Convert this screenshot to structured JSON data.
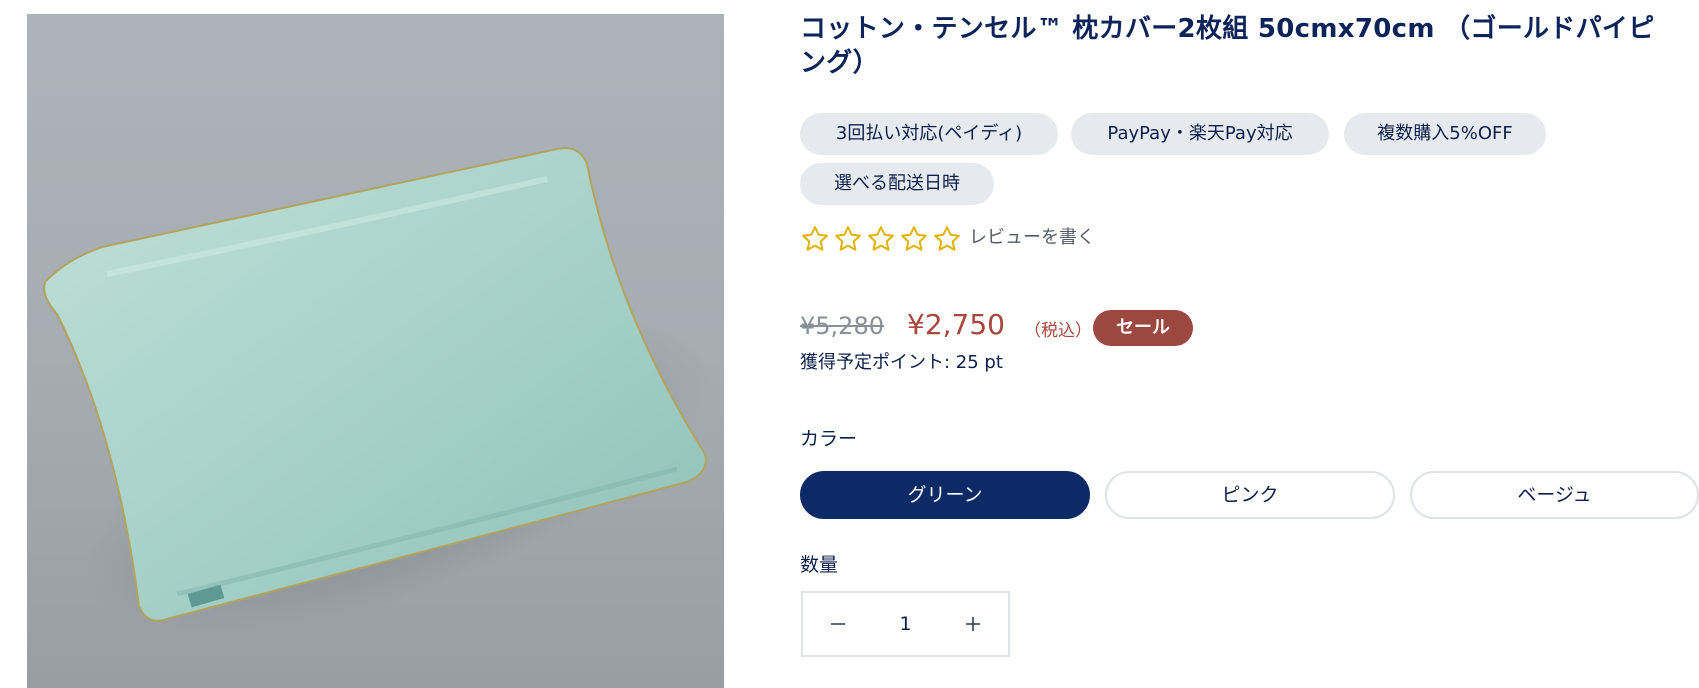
{
  "product": {
    "title": "コットン・テンセル™ 枕カバー2枚組 50cmx70cm （ゴールドパイピング）",
    "tags": [
      "3回払い対応(ペイディ)",
      "PayPay・楽天Pay対応",
      "複数購入5%OFF",
      "選べる配送日時"
    ],
    "rating": {
      "stars_filled": 0,
      "stars_total": 5,
      "review_link": "レビューを書く"
    },
    "price": {
      "original": "¥5,280",
      "sale": "¥2,750",
      "tax_note": "（税込）",
      "badge": "セール"
    },
    "points": "獲得予定ポイント: 25 pt",
    "color": {
      "label": "カラー",
      "options": [
        "グリーン",
        "ピンク",
        "ベージュ"
      ],
      "selected": "グリーン"
    },
    "quantity": {
      "label": "数量",
      "value": "1"
    }
  },
  "colors": {
    "title": "#0c2459",
    "sale_price": "#a9463e",
    "sale_badge": "#9c4740",
    "selected_variant": "#0c2a66",
    "tag_background": "#e6eaef",
    "star_outline": "#e2b200"
  },
  "icons": {
    "stars": "star-outline-icon",
    "quantity_decrease": "minus-icon",
    "quantity_increase": "plus-icon"
  }
}
